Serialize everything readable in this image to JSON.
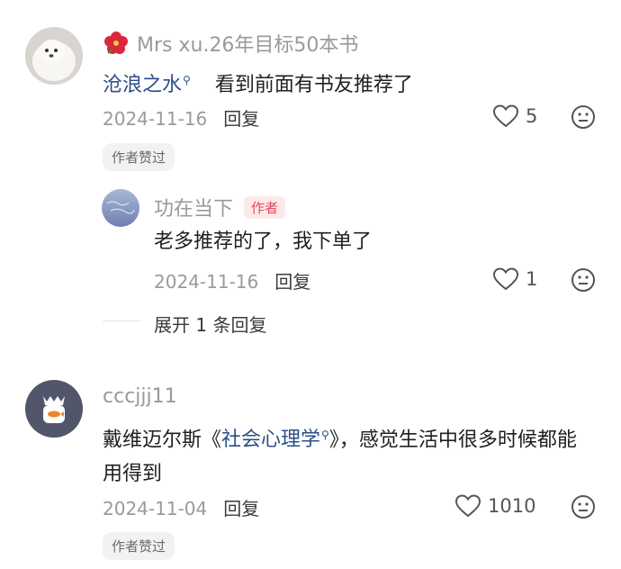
{
  "comments": [
    {
      "username": "Mrs xu.26年目标50本书",
      "badge_icon": "hibiscus-flower-icon",
      "text_link": "沧浪之水",
      "text_rest": "看到前面有书友推荐了",
      "date": "2024-11-16",
      "reply_label": "回复",
      "like_count": "5",
      "author_liked": "作者赞过",
      "replies": [
        {
          "username": "功在当下",
          "author_tag": "作者",
          "text": "老多推荐的了，我下单了",
          "date": "2024-11-16",
          "reply_label": "回复",
          "like_count": "1"
        }
      ],
      "expand_label": "展开 1 条回复"
    },
    {
      "username": "cccjjj11",
      "text_prefix": "戴维迈尔斯《",
      "text_link": "社会心理学",
      "text_suffix": "》，感觉生活中很多时候都能用得到",
      "date": "2024-11-04",
      "reply_label": "回复",
      "like_count": "1010",
      "author_liked": "作者赞过"
    }
  ],
  "icons": {
    "like": "heart-outline-icon",
    "dislike": "neutral-face-icon",
    "search": "search-mark-icon"
  },
  "colors": {
    "link": "#2b4f86",
    "author_tag_bg": "#fde8ea",
    "author_tag_text": "#e04a5c",
    "hibiscus": "#d9273c"
  }
}
